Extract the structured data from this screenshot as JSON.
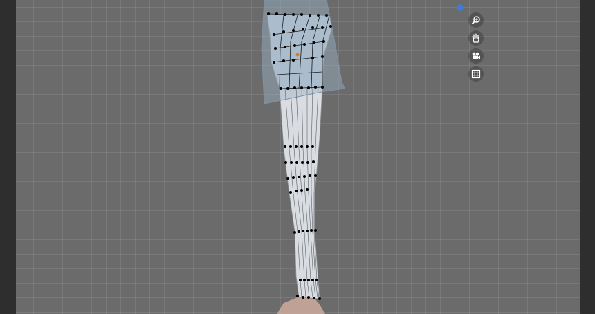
{
  "app": {
    "name": "3D Viewport",
    "mode": "edit-mode"
  },
  "colors": {
    "viewport_bg": "#6b6b6b",
    "panel_bg": "#2e2e2e",
    "axis_y_line": "#8db34e",
    "mesh_fill": "#d9dde2",
    "wire": "#1a1a1a",
    "vertex": "#000000",
    "active_vertex": "#e07a1f",
    "skirt_fill": "#9bb3c8",
    "axis_gizmo_dot": "#3d7bd6"
  },
  "navigation_gizmo": {
    "buttons": [
      {
        "name": "zoom",
        "icon": "zoom-icon"
      },
      {
        "name": "pan",
        "icon": "hand-icon"
      },
      {
        "name": "camera",
        "icon": "camera-icon"
      },
      {
        "name": "orthographic",
        "icon": "grid-icon"
      }
    ]
  }
}
